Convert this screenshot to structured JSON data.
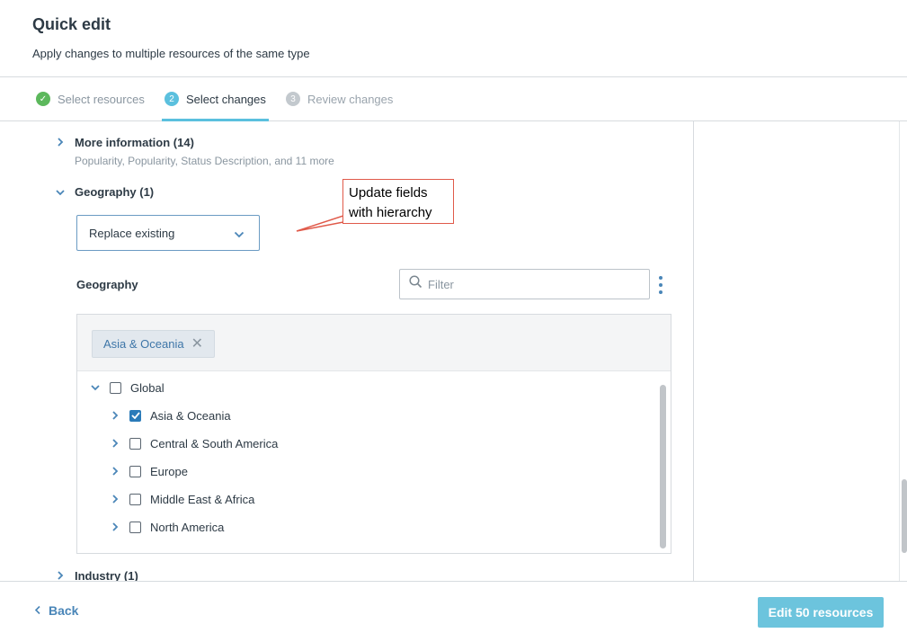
{
  "header": {
    "title": "Quick edit",
    "subtitle": "Apply changes to multiple resources of the same type"
  },
  "steps": [
    {
      "number": "✓",
      "label": "Select resources",
      "state": "complete"
    },
    {
      "number": "2",
      "label": "Select changes",
      "state": "active"
    },
    {
      "number": "3",
      "label": "Review changes",
      "state": "upcoming"
    }
  ],
  "sections": {
    "more_information": {
      "title": "More information (14)",
      "description": "Popularity, Popularity, Status Description, and 11 more",
      "expanded": false
    },
    "geography": {
      "title": "Geography (1)",
      "expanded": true,
      "mode_select": "Replace existing",
      "field_label": "Geography",
      "filter_placeholder": "Filter",
      "selected_chips": [
        "Asia & Oceania"
      ],
      "tree": [
        {
          "label": "Global",
          "level": 0,
          "expanded": true,
          "checked": false
        },
        {
          "label": "Asia & Oceania",
          "level": 1,
          "expanded": false,
          "checked": true
        },
        {
          "label": "Central & South America",
          "level": 1,
          "expanded": false,
          "checked": false
        },
        {
          "label": "Europe",
          "level": 1,
          "expanded": false,
          "checked": false
        },
        {
          "label": "Middle East & Africa",
          "level": 1,
          "expanded": false,
          "checked": false
        },
        {
          "label": "North America",
          "level": 1,
          "expanded": false,
          "checked": false
        }
      ]
    },
    "industry": {
      "title": "Industry (1)",
      "expanded": false
    }
  },
  "callout": {
    "line1": "Update fields",
    "line2": "with hierarchy"
  },
  "footer": {
    "back_label": "Back",
    "primary_label": "Edit 50 resources"
  },
  "colors": {
    "accent": "#5bc0de",
    "link": "#4a86b8",
    "primary_button": "#6cc4dd",
    "success": "#5cb85c",
    "checkbox_checked": "#2b7bb9",
    "callout_border": "#e05a4a"
  },
  "icons": {
    "step_complete": "check-circle-icon",
    "expand": "chevron-right-icon",
    "collapse": "chevron-down-icon",
    "search": "search-icon",
    "more": "kebab-menu-icon",
    "remove": "close-icon",
    "back": "chevron-left-icon"
  }
}
